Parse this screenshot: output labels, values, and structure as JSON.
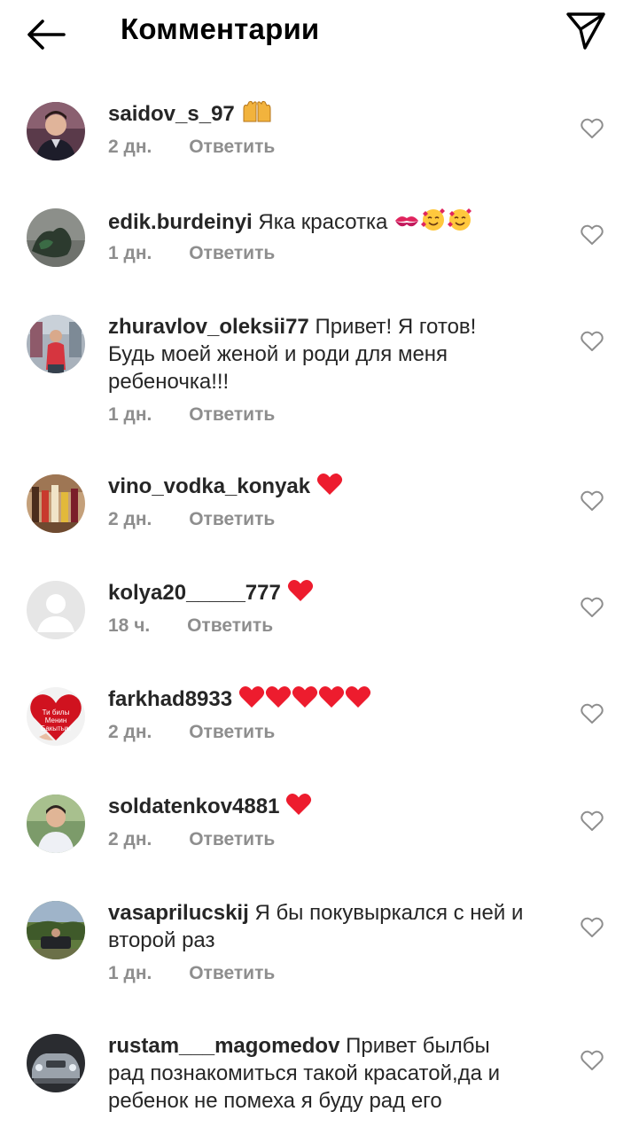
{
  "header": {
    "title": "Комментарии",
    "back_icon": "arrow-left-icon",
    "send_icon": "paper-plane-icon"
  },
  "colors": {
    "text": "#262626",
    "meta": "#8e8e8e",
    "heart_red": "#ed4956"
  },
  "comments": [
    {
      "username": "saidov_s_97",
      "text": "",
      "emoji": "raising-hands",
      "time": "2 дн.",
      "reply": "Ответить"
    },
    {
      "username": "edik.burdeinyi",
      "text": "Яка красотка",
      "emoji": "kiss-mark, smiling-face-with-hearts x2",
      "time": "1 дн.",
      "reply": "Ответить"
    },
    {
      "username": "zhuravlov_oleksii77",
      "text": "Привет! Я готов! Будь моей женой и роди для меня ребеночка!!!",
      "emoji": "",
      "time": "1 дн.",
      "reply": "Ответить"
    },
    {
      "username": "vino_vodka_konyak",
      "text": "",
      "emoji": "red-heart",
      "time": "2 дн.",
      "reply": "Ответить"
    },
    {
      "username": "kolya20_____777",
      "text": "",
      "emoji": "red-heart",
      "time": "18 ч.",
      "reply": "Ответить"
    },
    {
      "username": "farkhad8933",
      "text": "",
      "emoji": "red-heart x5",
      "time": "2 дн.",
      "reply": "Ответить",
      "avatar_caption": "Ти билы Менин Бакытым"
    },
    {
      "username": "soldatenkov4881",
      "text": "",
      "emoji": "red-heart",
      "time": "2 дн.",
      "reply": "Ответить"
    },
    {
      "username": "vasaprilucskij",
      "text": "Я бы покувыркался с ней и второй раз",
      "emoji": "",
      "time": "1 дн.",
      "reply": "Ответить"
    },
    {
      "username": "rustam___magomedov",
      "text": "Привет былбы рад познакомиться такой красатой,да и ребенок не помеха я буду рад его",
      "emoji": "",
      "time": "",
      "reply": ""
    }
  ]
}
